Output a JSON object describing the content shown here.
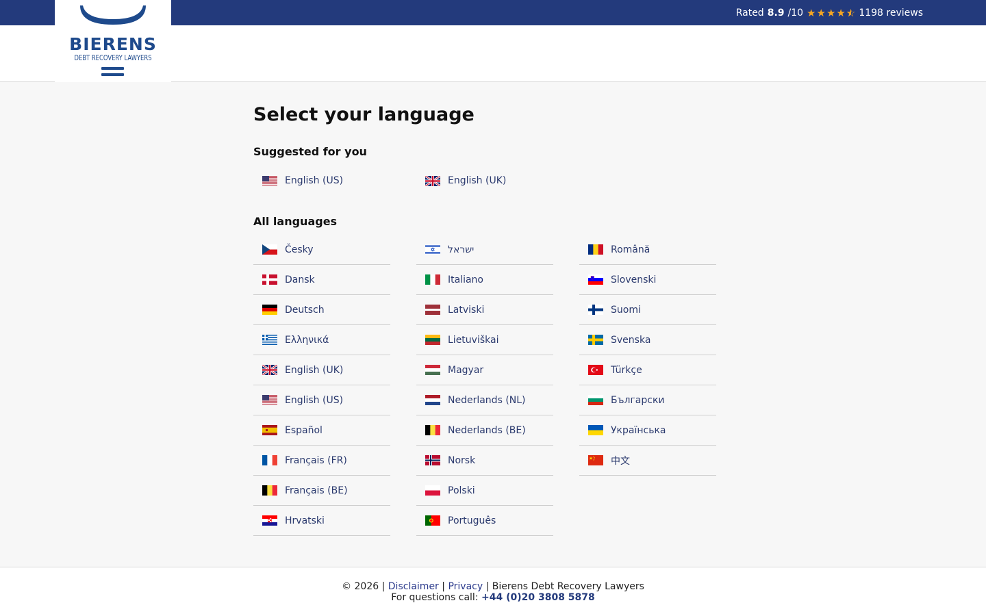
{
  "topbar": {
    "rated_label": "Rated",
    "score": "8.9",
    "scale": "/10",
    "stars_value": 4.5,
    "reviews": "1198 reviews",
    "star_color": "#f5a623"
  },
  "logo": {
    "name": "BIERENS",
    "subtitle": "DEBT RECOVERY LAWYERS"
  },
  "page": {
    "title": "Select your language",
    "suggested_heading": "Suggested for you",
    "all_heading": "All languages"
  },
  "suggested": [
    {
      "label": "English (US)",
      "flag": "us"
    },
    {
      "label": "English (UK)",
      "flag": "uk"
    }
  ],
  "languages": [
    {
      "label": "Česky",
      "flag": "cz"
    },
    {
      "label": "Dansk",
      "flag": "dk"
    },
    {
      "label": "Deutsch",
      "flag": "de"
    },
    {
      "label": "Ελληνικά",
      "flag": "gr"
    },
    {
      "label": "English (UK)",
      "flag": "uk"
    },
    {
      "label": "English (US)",
      "flag": "us"
    },
    {
      "label": "Español",
      "flag": "es"
    },
    {
      "label": "Français (FR)",
      "flag": "fr"
    },
    {
      "label": "Français (BE)",
      "flag": "be"
    },
    {
      "label": "Hrvatski",
      "flag": "hr"
    },
    {
      "label": "ישראל",
      "flag": "il"
    },
    {
      "label": "Italiano",
      "flag": "it"
    },
    {
      "label": "Latviski",
      "flag": "lv"
    },
    {
      "label": "Lietuviškai",
      "flag": "lt"
    },
    {
      "label": "Magyar",
      "flag": "hu"
    },
    {
      "label": "Nederlands (NL)",
      "flag": "nl"
    },
    {
      "label": "Nederlands (BE)",
      "flag": "be"
    },
    {
      "label": "Norsk",
      "flag": "no"
    },
    {
      "label": "Polski",
      "flag": "pl"
    },
    {
      "label": "Português",
      "flag": "pt"
    },
    {
      "label": "Română",
      "flag": "ro"
    },
    {
      "label": "Slovenski",
      "flag": "si"
    },
    {
      "label": "Suomi",
      "flag": "fi"
    },
    {
      "label": "Svenska",
      "flag": "se"
    },
    {
      "label": "Türkçe",
      "flag": "tr"
    },
    {
      "label": "Български",
      "flag": "bg"
    },
    {
      "label": "Українська",
      "flag": "ua"
    },
    {
      "label": "中文",
      "flag": "cn"
    }
  ],
  "footer": {
    "copyright": "© 2026 |",
    "disclaimer": "Disclaimer",
    "sep": "|",
    "privacy": "Privacy",
    "company": "| Bierens Debt Recovery Lawyers",
    "call_label": "For questions call:",
    "phone": "+44 (0)20 3808 5878"
  },
  "colors": {
    "brand_navy": "#233a7c",
    "logo_blue": "#1e4a8c",
    "link": "#2b3a6e"
  }
}
